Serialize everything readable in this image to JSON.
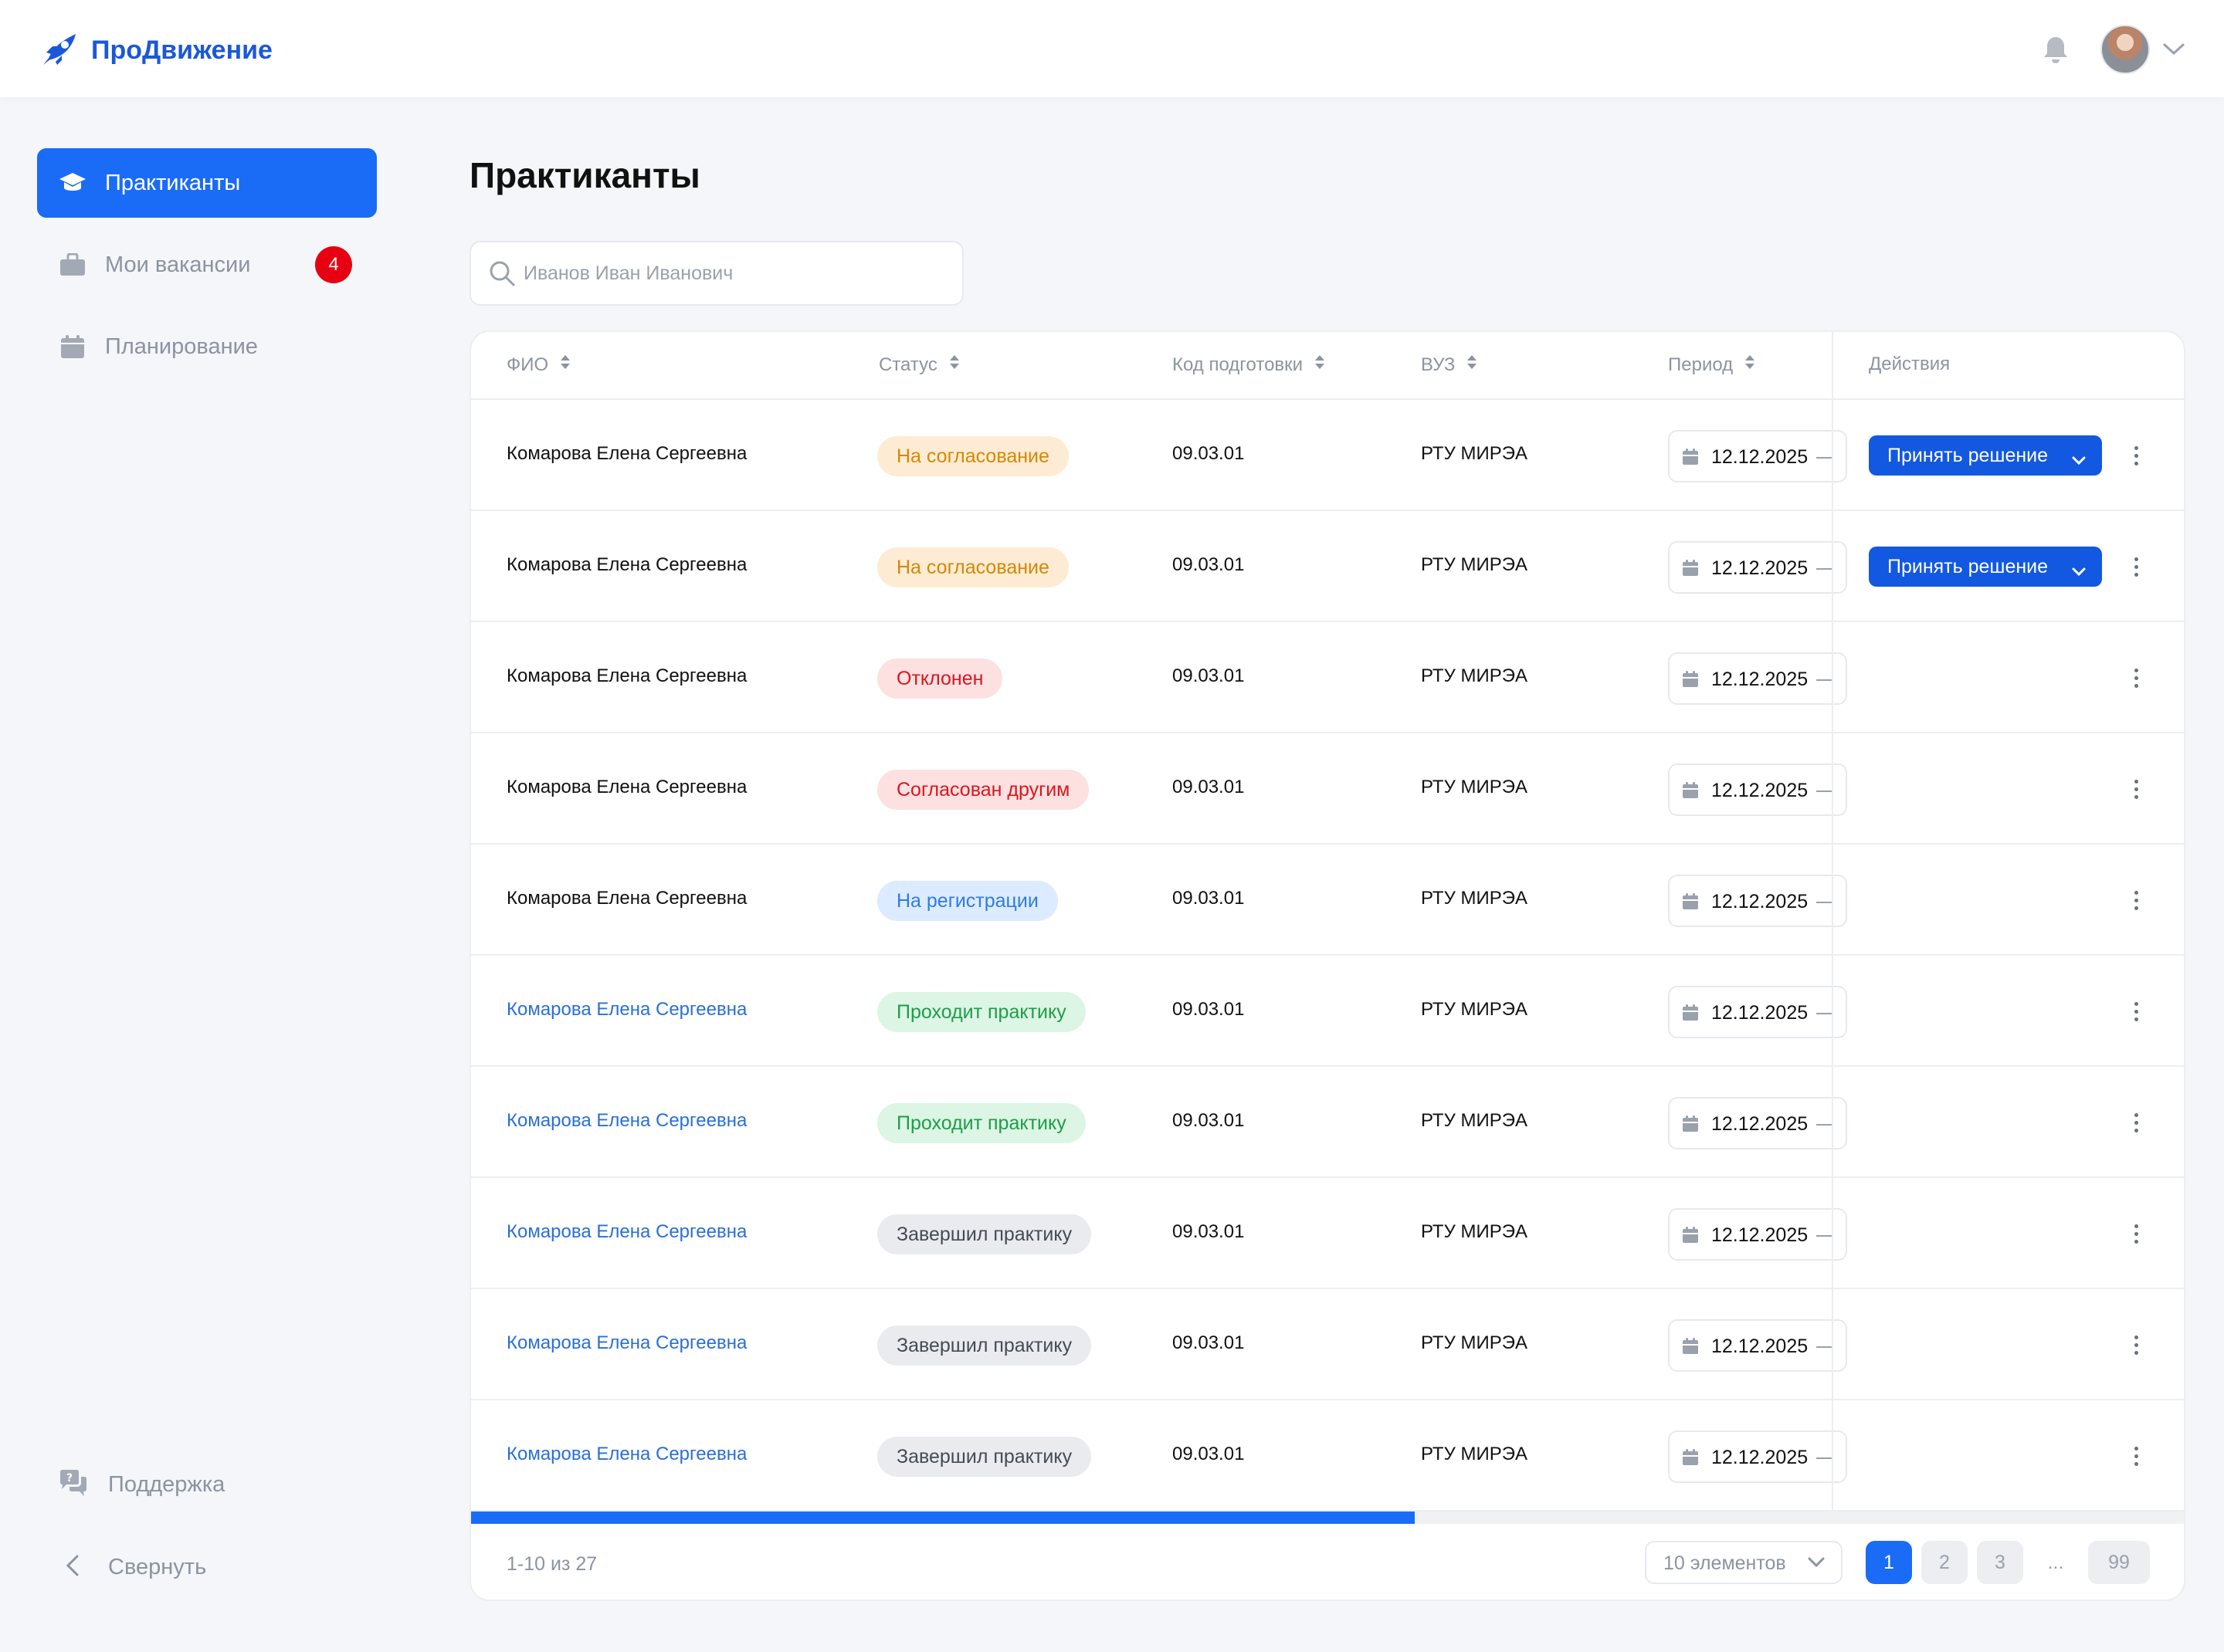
{
  "app": {
    "brand": "ПроДвижение"
  },
  "sidebar": {
    "items": [
      {
        "label": "Практиканты",
        "active": true,
        "icon": "graduation-cap-icon"
      },
      {
        "label": "Мои вакансии",
        "badge": "4",
        "icon": "briefcase-icon"
      },
      {
        "label": "Планирование",
        "icon": "calendar-icon"
      }
    ],
    "support_label": "Поддержка",
    "collapse_label": "Свернуть"
  },
  "page": {
    "title": "Практиканты"
  },
  "search": {
    "placeholder": "Иванов Иван Иванович",
    "value": ""
  },
  "table": {
    "columns": [
      "ФИО",
      "Статус",
      "Код подготовки",
      "ВУЗ",
      "Период",
      "Действия"
    ],
    "decide_label": "Принять решение",
    "rows": [
      {
        "name": "Комарова Елена Сергеевна",
        "link": false,
        "status": "На согласование",
        "status_kind": "approval",
        "code": "09.03.01",
        "university": "РТУ МИРЭА",
        "period": "12.12.2025",
        "has_decide": true
      },
      {
        "name": "Комарова Елена Сергеевна",
        "link": false,
        "status": "На согласование",
        "status_kind": "approval",
        "code": "09.03.01",
        "university": "РТУ МИРЭА",
        "period": "12.12.2025",
        "has_decide": true
      },
      {
        "name": "Комарова Елена Сергеевна",
        "link": false,
        "status": "Отклонен",
        "status_kind": "rejected",
        "code": "09.03.01",
        "university": "РТУ МИРЭА",
        "period": "12.12.2025",
        "has_decide": false
      },
      {
        "name": "Комарова Елена Сергеевна",
        "link": false,
        "status": "Согласован другим",
        "status_kind": "other",
        "code": "09.03.01",
        "university": "РТУ МИРЭА",
        "period": "12.12.2025",
        "has_decide": false
      },
      {
        "name": "Комарова Елена Сергеевна",
        "link": false,
        "status": "На регистрации",
        "status_kind": "reg",
        "code": "09.03.01",
        "university": "РТУ МИРЭА",
        "period": "12.12.2025",
        "has_decide": false
      },
      {
        "name": "Комарова Елена Сергеевна",
        "link": true,
        "status": "Проходит практику",
        "status_kind": "practice",
        "code": "09.03.01",
        "university": "РТУ МИРЭА",
        "period": "12.12.2025",
        "has_decide": false
      },
      {
        "name": "Комарова Елена Сергеевна",
        "link": true,
        "status": "Проходит практику",
        "status_kind": "practice",
        "code": "09.03.01",
        "university": "РТУ МИРЭА",
        "period": "12.12.2025",
        "has_decide": false
      },
      {
        "name": "Комарова Елена Сергеевна",
        "link": true,
        "status": "Завершил практику",
        "status_kind": "done",
        "code": "09.03.01",
        "university": "РТУ МИРЭА",
        "period": "12.12.2025",
        "has_decide": false
      },
      {
        "name": "Комарова Елена Сергеевна",
        "link": true,
        "status": "Завершил практику",
        "status_kind": "done",
        "code": "09.03.01",
        "university": "РТУ МИРЭА",
        "period": "12.12.2025",
        "has_decide": false
      },
      {
        "name": "Комарова Елена Сергеевна",
        "link": true,
        "status": "Завершил практику",
        "status_kind": "done",
        "code": "09.03.01",
        "university": "РТУ МИРЭА",
        "period": "12.12.2025",
        "has_decide": false
      }
    ],
    "horizontal_scroll_fraction": 0.3
  },
  "pagination": {
    "range_text": "1-10 из 27",
    "page_size_label": "10 элементов",
    "pages": [
      "1",
      "2",
      "3",
      "...",
      "99"
    ],
    "current_page": "1"
  },
  "colors": {
    "accent": "#1a6cf6",
    "button": "#1358e0",
    "badge": "#e60012",
    "link": "#2a6fd6"
  }
}
